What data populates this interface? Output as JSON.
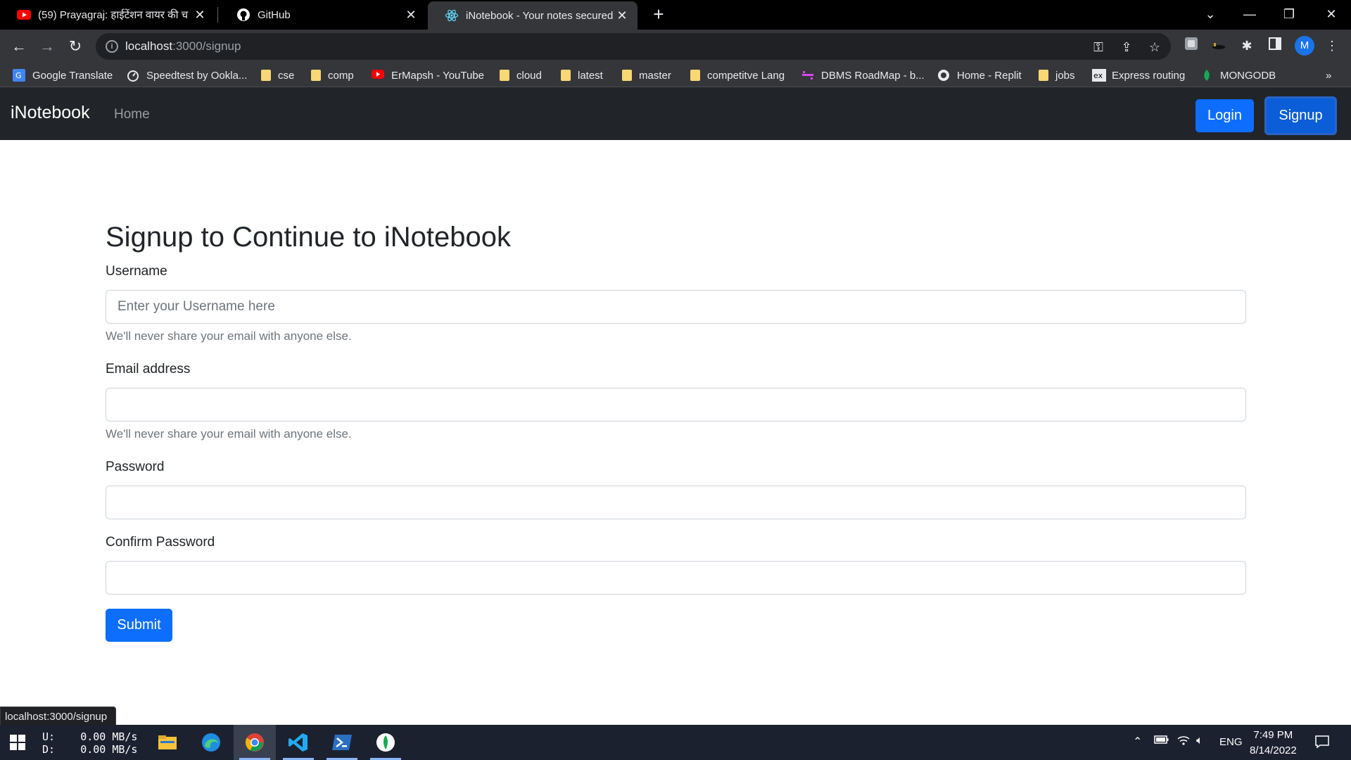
{
  "browser": {
    "tabs": [
      {
        "title": "(59) Prayagraj: हाईटेंशन वायर की च",
        "icon": "youtube-icon"
      },
      {
        "title": "GitHub",
        "icon": "github-icon"
      },
      {
        "title": "iNotebook - Your notes secured o",
        "icon": "react-icon"
      }
    ],
    "address": {
      "host": "localhost",
      "path": ":3000/signup"
    },
    "profile_initial": "M",
    "bookmarks": [
      {
        "label": "Google Translate",
        "icon": "google-translate-icon"
      },
      {
        "label": "Speedtest by Ookla...",
        "icon": "speedtest-icon"
      },
      {
        "label": "cse",
        "icon": "folder-icon"
      },
      {
        "label": "comp",
        "icon": "folder-icon"
      },
      {
        "label": "ErMapsh - YouTube",
        "icon": "youtube-icon"
      },
      {
        "label": "cloud",
        "icon": "folder-icon"
      },
      {
        "label": "latest",
        "icon": "folder-icon"
      },
      {
        "label": "master",
        "icon": "folder-icon"
      },
      {
        "label": "competitve Lang",
        "icon": "folder-icon"
      },
      {
        "label": "DBMS RoadMap - b...",
        "icon": "roadmap-icon"
      },
      {
        "label": "Home - Replit",
        "icon": "replit-icon"
      },
      {
        "label": "jobs",
        "icon": "folder-icon"
      },
      {
        "label": "Express routing",
        "icon": "express-icon"
      },
      {
        "label": "MONGODB",
        "icon": "mongodb-icon"
      }
    ],
    "bookmarks_overflow": "»",
    "status_url": "localhost:3000/signup"
  },
  "app": {
    "brand": "iNotebook",
    "nav_home": "Home",
    "login_label": "Login",
    "signup_label": "Signup"
  },
  "form": {
    "title": "Signup to Continue to iNotebook",
    "username_label": "Username",
    "username_placeholder": "Enter your Username here",
    "username_value": "",
    "username_help": "We'll never share your email with anyone else.",
    "email_label": "Email address",
    "email_value": "",
    "email_help": "We'll never share your email with anyone else.",
    "password_label": "Password",
    "password_value": "",
    "confirm_label": "Confirm Password",
    "confirm_value": "",
    "submit_label": "Submit"
  },
  "taskbar": {
    "upload_label": "U:",
    "download_label": "D:",
    "upload_speed": "0.00 MB/s",
    "download_speed": "0.00 MB/s",
    "language": "ENG",
    "time": "7:49 PM",
    "date": "8/14/2022"
  }
}
